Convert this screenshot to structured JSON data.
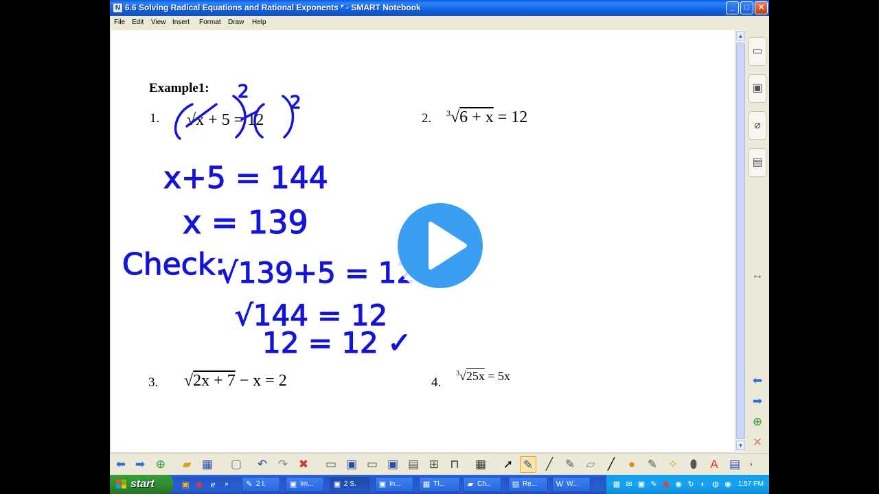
{
  "window": {
    "title": "6.6 Solving Radical Equations and Rational Exponents * - SMART Notebook",
    "controls": {
      "minimize": "_",
      "maximize": "□",
      "close": "✕"
    }
  },
  "menu": [
    "File",
    "Edit",
    "View",
    "Insert",
    "Format",
    "Draw",
    "Help"
  ],
  "content": {
    "example_label": "Example1:",
    "problems": [
      {
        "num": "1.",
        "equation": "√x + 5 = 12"
      },
      {
        "num": "2.",
        "index": "3",
        "radicand": "6 + x",
        "rhs": "= 12"
      },
      {
        "num": "3.",
        "radicand": "2x + 7",
        "rest": "− x = 2"
      },
      {
        "num": "4.",
        "index": "3",
        "radicand": "25x",
        "rhs": "= 5x"
      }
    ],
    "handwriting": [
      "2",
      "2",
      "x+5 = 144",
      "x = 139",
      "Check:",
      "√139+5 = 12",
      "√144 = 12",
      "12 = 12 ✓"
    ]
  },
  "icons": {
    "side_tabs": [
      "page-sorter-icon",
      "gallery-icon",
      "attachments-icon",
      "properties-icon"
    ],
    "side_nav": [
      "previous-page-icon",
      "next-page-icon",
      "add-page-icon",
      "delete-page-icon"
    ],
    "toolbar": [
      "back-icon",
      "forward-icon",
      "add-page-icon",
      "open-icon",
      "save-icon",
      "paste-icon",
      "undo-icon",
      "redo-icon",
      "delete-icon",
      "screen-shade-icon",
      "full-screen-icon",
      "dual-page-icon",
      "capture-icon",
      "document-camera-icon",
      "measurement-icon",
      "table-icon",
      "select-icon",
      "pen-icon",
      "creative-pen-icon",
      "magic-pen-icon",
      "highlighter-icon",
      "line-icon",
      "shapes-icon",
      "fill-icon",
      "magic-wand-icon",
      "eraser-icon",
      "text-icon",
      "properties-icon"
    ]
  },
  "taskbar": {
    "start_label": "start",
    "buttons": [
      {
        "label": "2 I."
      },
      {
        "label": "Im..."
      },
      {
        "label": "2 S."
      },
      {
        "label": "In..."
      },
      {
        "label": "TI..."
      },
      {
        "label": "Ch..."
      },
      {
        "label": "Re..."
      },
      {
        "label": "W..."
      }
    ],
    "clock": "1:57 PM"
  },
  "colors": {
    "ink": "#1414d8",
    "titlebar": "#0a5ce4",
    "play": "#3a9ff2",
    "taskbar": "#2456c8",
    "start": "#2f8a2f"
  }
}
